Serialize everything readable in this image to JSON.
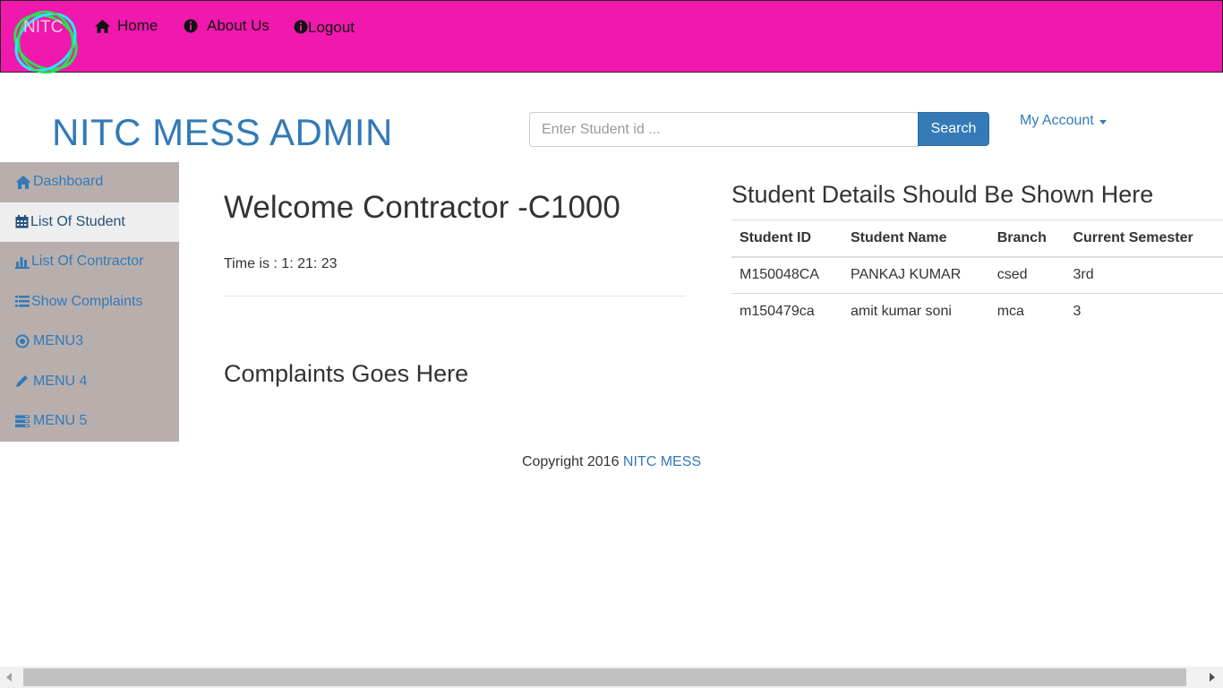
{
  "colors": {
    "navbar_bg": "#f118ad",
    "brand_blue": "#337ab7",
    "sidebar_bg": "#b8afad",
    "sidebar_active_bg": "#eeeeee"
  },
  "navbar": {
    "logo_text": "NITC",
    "items": [
      {
        "label": "Home",
        "icon": "home-icon"
      },
      {
        "label": "About Us",
        "icon": "info-circle-icon"
      },
      {
        "label": "Logout",
        "icon": "info-circle-icon"
      }
    ]
  },
  "header": {
    "brand": "NITC MESS ADMIN",
    "search_placeholder": "Enter Student id ...",
    "search_button": "Search",
    "account_label": "My Account"
  },
  "sidebar": {
    "items": [
      {
        "label": "Dashboard",
        "icon": "home-icon",
        "active": false
      },
      {
        "label": "List Of Student",
        "icon": "calendar-icon",
        "active": true
      },
      {
        "label": "List Of Contractor",
        "icon": "bar-chart-icon",
        "active": false
      },
      {
        "label": "Show Complaints",
        "icon": "list-icon",
        "active": false
      },
      {
        "label": "MENU3",
        "icon": "record-icon",
        "active": false
      },
      {
        "label": "MENU 4",
        "icon": "pencil-icon",
        "active": false
      },
      {
        "label": "MENU 5",
        "icon": "tasks-icon",
        "active": false
      }
    ]
  },
  "main": {
    "welcome": "Welcome Contractor -C1000",
    "time": "Time is : 1: 21: 23",
    "complaints_heading": "Complaints Goes Here"
  },
  "details": {
    "title": "Student Details Should Be Shown Here",
    "columns": [
      "Student ID",
      "Student Name",
      "Branch",
      "Current Semester"
    ],
    "rows": [
      [
        "M150048CA",
        "PANKAJ KUMAR",
        "csed",
        "3rd"
      ],
      [
        "m150479ca",
        "amit kumar soni",
        "mca",
        "3"
      ]
    ]
  },
  "footer": {
    "text": "Copyright 2016",
    "link": "NITC MESS"
  }
}
